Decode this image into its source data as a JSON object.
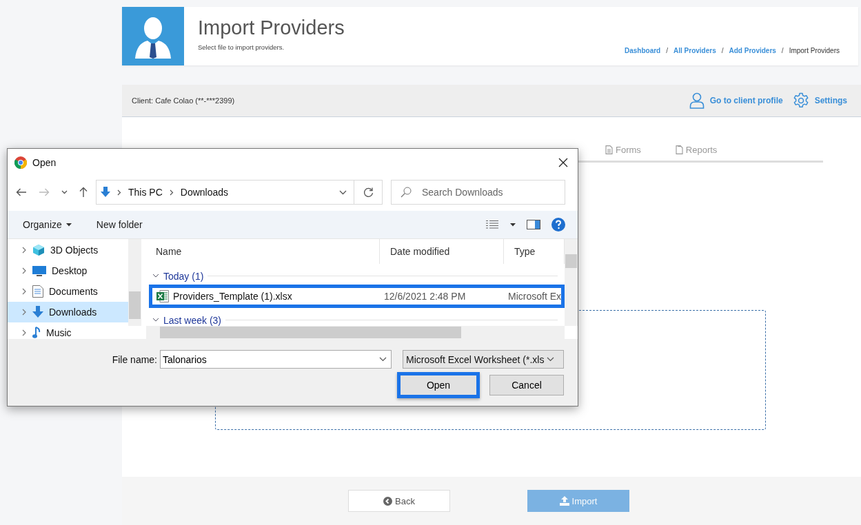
{
  "header": {
    "title": "Import Providers",
    "subtitle": "Select file to import providers.",
    "separator": "/",
    "breadcrumbs": [
      {
        "label": "Dashboard",
        "link": true
      },
      {
        "label": "All Providers",
        "link": true
      },
      {
        "label": "Add Providers",
        "link": true
      },
      {
        "label": "Import Providers",
        "link": false
      }
    ]
  },
  "client_bar": {
    "label": "Client:",
    "name": "Cafe Colao (**-***2399)",
    "actions": [
      {
        "label": "Go to client profile",
        "kind": "profile"
      },
      {
        "label": "Settings",
        "kind": "settings"
      }
    ]
  },
  "tabs": [
    {
      "label": "Forms",
      "kind": "form",
      "selected": false
    },
    {
      "label": "Reports",
      "kind": "report",
      "selected": false
    }
  ],
  "footer": {
    "buttons": [
      {
        "label": "Back",
        "kind": "back",
        "disabled": false
      },
      {
        "label": "Import",
        "kind": "import",
        "disabled": true
      }
    ]
  },
  "dialog": {
    "title": "Open",
    "path": [
      "This PC",
      "Downloads"
    ],
    "search": {
      "placeholder": "Search Downloads"
    },
    "commands": [
      {
        "label": "Organize",
        "kind": "menu"
      },
      {
        "label": "New folder",
        "kind": "button"
      }
    ],
    "tree": [
      {
        "label": "3D Objects",
        "kind": "cube",
        "selected": false,
        "expanded": false
      },
      {
        "label": "Desktop",
        "kind": "desktop",
        "selected": false,
        "expanded": false
      },
      {
        "label": "Documents",
        "kind": "document",
        "selected": false,
        "expanded": false
      },
      {
        "label": "Downloads",
        "kind": "download",
        "selected": true,
        "expanded": false
      },
      {
        "label": "Music",
        "kind": "music",
        "selected": false,
        "expanded": false
      }
    ],
    "columns": [
      "Name",
      "Date modified",
      "Type"
    ],
    "groups": [
      {
        "label": "Today (1)",
        "expanded": true,
        "files": [
          {
            "name": "Providers_Template (1).xlsx",
            "date": "12/6/2021 2:48 PM",
            "type": "Microsoft Ex",
            "highlighted": true
          }
        ]
      },
      {
        "label": "Last week (3)",
        "expanded": true
      }
    ],
    "file_name": {
      "label": "File name:",
      "value": "Talonarios"
    },
    "file_type": "Microsoft Excel Worksheet (*.xls",
    "buttons": [
      {
        "label": "Open",
        "kind": "open",
        "highlighted": true
      },
      {
        "label": "Cancel",
        "kind": "cancel",
        "highlighted": false
      }
    ]
  }
}
